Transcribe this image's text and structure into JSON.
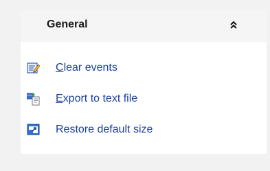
{
  "panel": {
    "title": "General",
    "collapse_icon": "double-chevron-up-icon",
    "items": [
      {
        "mnemonic": "C",
        "rest": "lear events",
        "icon": "edit-note-icon",
        "style": "link"
      },
      {
        "mnemonic": "E",
        "rest": "xport to text file",
        "icon": "export-file-icon",
        "style": "link"
      },
      {
        "label": "Restore default size",
        "icon": "restore-size-icon",
        "style": "plain"
      }
    ]
  },
  "colors": {
    "background": "#f2f2f2",
    "panel": "#ffffff",
    "header": "#f5f5f5",
    "link": "#1b3fa0"
  }
}
